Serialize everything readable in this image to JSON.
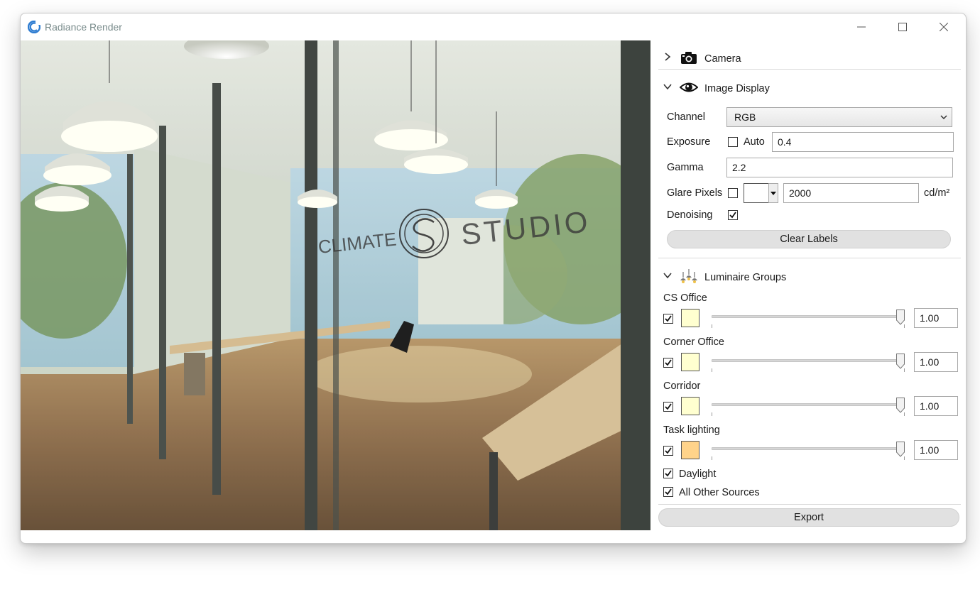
{
  "window": {
    "title": "Radiance Render"
  },
  "viewport": {
    "watermark_left": "CLIMATE",
    "watermark_right": "STUDIO"
  },
  "camera": {
    "title": "Camera",
    "expanded": false
  },
  "image_display": {
    "title": "Image Display",
    "channel_label": "Channel",
    "channel_value": "RGB",
    "exposure_label": "Exposure",
    "auto_label": "Auto",
    "auto_checked": false,
    "exposure_value": "0.4",
    "gamma_label": "Gamma",
    "gamma_value": "2.2",
    "glare_label": "Glare Pixels",
    "glare_checked": false,
    "glare_value": "2000",
    "glare_unit": "cd/m²",
    "denoising_label": "Denoising",
    "denoising_checked": true,
    "clear_labels": "Clear Labels"
  },
  "luminaire_groups": {
    "title": "Luminaire Groups",
    "groups": [
      {
        "name": "CS Office",
        "checked": true,
        "color": "#ffffd0",
        "value": "1.00",
        "level": 1.0
      },
      {
        "name": "Corner Office",
        "checked": true,
        "color": "#ffffd0",
        "value": "1.00",
        "level": 1.0
      },
      {
        "name": "Corridor",
        "checked": true,
        "color": "#ffffd0",
        "value": "1.00",
        "level": 1.0
      },
      {
        "name": "Task lighting",
        "checked": true,
        "color": "#ffd38a",
        "value": "1.00",
        "level": 1.0
      }
    ],
    "daylight_label": "Daylight",
    "daylight_checked": true,
    "other_label": "All Other Sources",
    "other_checked": true
  },
  "export_label": "Export",
  "colors": {
    "accent": "#1a73e8",
    "title_text": "#7a8c8c",
    "button_bg": "#e1e1e1"
  }
}
